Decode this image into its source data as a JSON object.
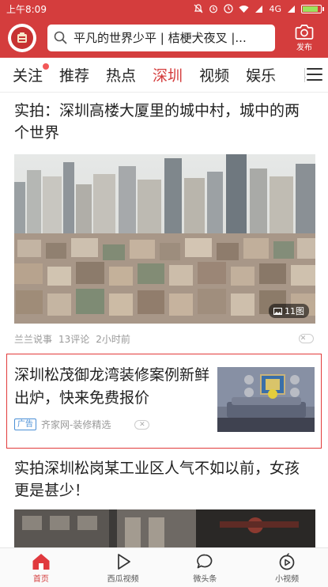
{
  "status": {
    "time": "上午8:09",
    "network": "4G",
    "battery_level": 0.85,
    "icons": [
      "mute-icon",
      "alarm-icon",
      "clock-icon",
      "wifi-icon",
      "signal-icon",
      "signal-icon",
      "battery-icon"
    ]
  },
  "header": {
    "search_placeholder": "平凡的世界少平 | 桔梗犬夜叉 |...",
    "publish_label": "发布",
    "colors": {
      "brand": "#d43d3d"
    }
  },
  "tabs": [
    {
      "label": "关注",
      "badge": true
    },
    {
      "label": "推荐"
    },
    {
      "label": "热点"
    },
    {
      "label": "深圳",
      "active": true
    },
    {
      "label": "视频"
    },
    {
      "label": "娱乐"
    },
    {
      "label": "科"
    }
  ],
  "feed": {
    "article1": {
      "title": "实拍：深圳高楼大厦里的城中村，城中的两个世界",
      "photo_count": "11图",
      "source": "兰兰说事",
      "comments": "13评论",
      "time": "2小时前",
      "dismiss": "✕"
    },
    "ad": {
      "title": "深圳松茂御龙湾装修案例新鲜出炉，快来免费报价",
      "tag": "广告",
      "source": "齐家网-装修精选",
      "dismiss": "✕"
    },
    "article3": {
      "title": "实拍深圳松岗某工业区人气不如以前，女孩更是甚少！"
    }
  },
  "bottom_nav": [
    {
      "label": "首页",
      "icon": "home-icon",
      "active": true
    },
    {
      "label": "西瓜视频",
      "icon": "play-icon"
    },
    {
      "label": "微头条",
      "icon": "chat-bubble-icon"
    },
    {
      "label": "小视频",
      "icon": "short-video-icon"
    }
  ]
}
